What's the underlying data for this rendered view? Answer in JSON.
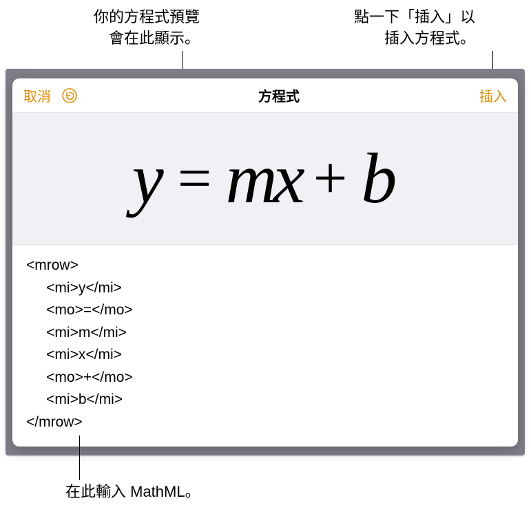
{
  "callouts": {
    "preview": "你的方程式預覽\n會在此顯示。",
    "insert": "點一下「插入」以\n插入方程式。",
    "mathml": "在此輸入 MathML。"
  },
  "toolbar": {
    "cancel": "取消",
    "title": "方程式",
    "insert": "插入"
  },
  "equation": {
    "y": "y",
    "eq": "=",
    "m": "m",
    "x": "x",
    "plus": "+",
    "b": "b"
  },
  "code": "<mrow>\n     <mi>y</mi>\n     <mo>=</mo>\n     <mi>m</mi>\n     <mi>x</mi>\n     <mo>+</mo>\n     <mi>b</mi>\n</mrow>",
  "colors": {
    "accent": "#e88c00",
    "previewBg": "#f2eff5",
    "frameBg": "#80808a"
  }
}
